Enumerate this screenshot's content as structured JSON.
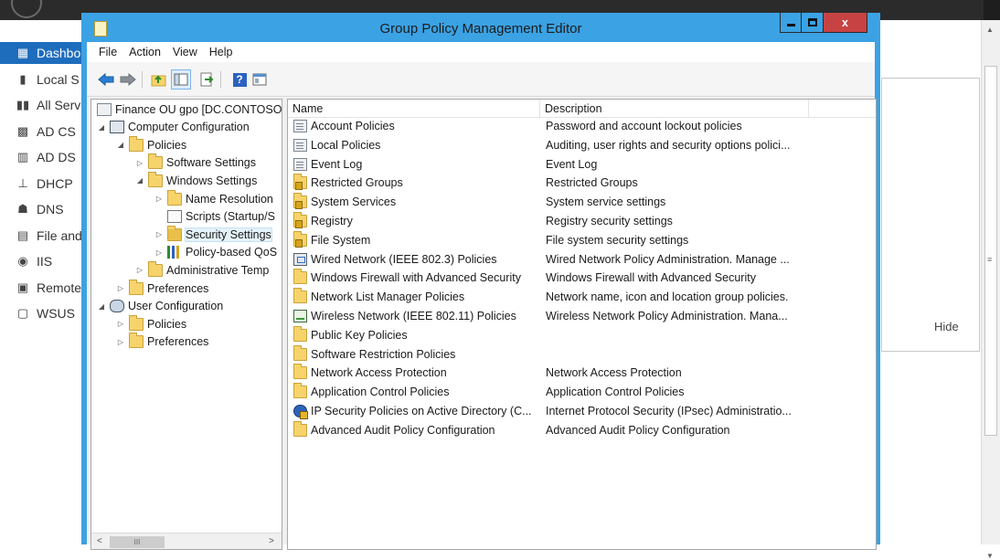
{
  "background_app": {
    "nav_items": [
      {
        "label": "Dashbo",
        "icon": "dashboard-grid-icon",
        "selected": true
      },
      {
        "label": "Local S",
        "icon": "server-icon"
      },
      {
        "label": "All Serv",
        "icon": "servers-icon"
      },
      {
        "label": "AD CS",
        "icon": "certificate-services-icon"
      },
      {
        "label": "AD DS",
        "icon": "directory-services-icon"
      },
      {
        "label": "DHCP",
        "icon": "dhcp-icon"
      },
      {
        "label": "DNS",
        "icon": "dns-icon"
      },
      {
        "label": "File and",
        "icon": "file-services-icon"
      },
      {
        "label": "IIS",
        "icon": "iis-icon"
      },
      {
        "label": "Remote",
        "icon": "remote-access-icon"
      },
      {
        "label": "WSUS",
        "icon": "wsus-icon"
      }
    ],
    "hide_label": "Hide",
    "scroll_grip": "≡"
  },
  "window": {
    "title": "Group Policy Management Editor",
    "controls": {
      "minimize": "minimize",
      "maximize": "maximize",
      "close_glyph": "x"
    }
  },
  "menu": [
    "File",
    "Action",
    "View",
    "Help"
  ],
  "toolbar": {
    "buttons": [
      "back-arrow-icon",
      "forward-arrow-icon",
      "up-folder-icon",
      "show-hide-tree-icon",
      "export-list-icon",
      "help-icon",
      "properties-icon"
    ],
    "help_glyph": "?"
  },
  "tree": {
    "items": [
      {
        "label": "Finance OU gpo [DC.CONTOSO",
        "level": 0,
        "expander": "",
        "icon": "gpo-document-icon"
      },
      {
        "label": "Computer Configuration",
        "level": 0,
        "expander": "◢",
        "icon": "computer-icon"
      },
      {
        "label": "Policies",
        "level": 1,
        "expander": "◢",
        "icon": "folder-icon"
      },
      {
        "label": "Software Settings",
        "level": 2,
        "expander": "▷",
        "icon": "folder-icon"
      },
      {
        "label": "Windows Settings",
        "level": 2,
        "expander": "◢",
        "icon": "folder-icon"
      },
      {
        "label": "Name Resolution",
        "level": 3,
        "expander": "▷",
        "icon": "folder-icon"
      },
      {
        "label": "Scripts (Startup/S",
        "level": 3,
        "expander": "",
        "icon": "scripts-icon"
      },
      {
        "label": "Security Settings",
        "level": 3,
        "expander": "▷",
        "icon": "security-settings-icon",
        "selected": true
      },
      {
        "label": "Policy-based QoS",
        "level": 3,
        "expander": "▷",
        "icon": "bar-chart-icon"
      },
      {
        "label": "Administrative Temp",
        "level": 2,
        "expander": "▷",
        "icon": "folder-icon"
      },
      {
        "label": "Preferences",
        "level": 1,
        "expander": "▷",
        "icon": "folder-icon"
      },
      {
        "label": "User Configuration",
        "level": 0,
        "expander": "◢",
        "icon": "users-icon"
      },
      {
        "label": "Policies",
        "level": 1,
        "expander": "▷",
        "icon": "folder-icon"
      },
      {
        "label": "Preferences",
        "level": 1,
        "expander": "▷",
        "icon": "folder-icon"
      }
    ],
    "scroll_left": "<",
    "scroll_right": ">",
    "scroll_thumb": "III"
  },
  "list": {
    "columns": [
      "Name",
      "Description"
    ],
    "rows": [
      {
        "name": "Account Policies",
        "description": "Password and account lockout policies",
        "icon": "doc"
      },
      {
        "name": "Local Policies",
        "description": "Auditing, user rights and security options polici...",
        "icon": "doc"
      },
      {
        "name": "Event Log",
        "description": "Event Log",
        "icon": "doc"
      },
      {
        "name": "Restricted Groups",
        "description": "Restricted Groups",
        "icon": "lockfolder"
      },
      {
        "name": "System Services",
        "description": "System service settings",
        "icon": "lockfolder"
      },
      {
        "name": "Registry",
        "description": "Registry security settings",
        "icon": "lockfolder"
      },
      {
        "name": "File System",
        "description": "File system security settings",
        "icon": "lockfolder"
      },
      {
        "name": "Wired Network (IEEE 802.3) Policies",
        "description": "Wired Network Policy Administration. Manage ...",
        "icon": "net"
      },
      {
        "name": "Windows Firewall with Advanced Security",
        "description": "Windows Firewall with Advanced Security",
        "icon": "folder"
      },
      {
        "name": "Network List Manager Policies",
        "description": "Network name, icon and location group policies.",
        "icon": "folder"
      },
      {
        "name": "Wireless Network (IEEE 802.11) Policies",
        "description": "Wireless Network Policy Administration. Mana...",
        "icon": "wifi"
      },
      {
        "name": "Public Key Policies",
        "description": "",
        "icon": "folder"
      },
      {
        "name": "Software Restriction Policies",
        "description": "",
        "icon": "folder"
      },
      {
        "name": "Network Access Protection",
        "description": "Network Access Protection",
        "icon": "folder"
      },
      {
        "name": "Application Control Policies",
        "description": "Application Control Policies",
        "icon": "folder"
      },
      {
        "name": "IP Security Policies on Active Directory (C...",
        "description": "Internet Protocol Security (IPsec) Administratio...",
        "icon": "ipsec"
      },
      {
        "name": "Advanced Audit Policy Configuration",
        "description": "Advanced Audit Policy Configuration",
        "icon": "folder"
      }
    ]
  }
}
